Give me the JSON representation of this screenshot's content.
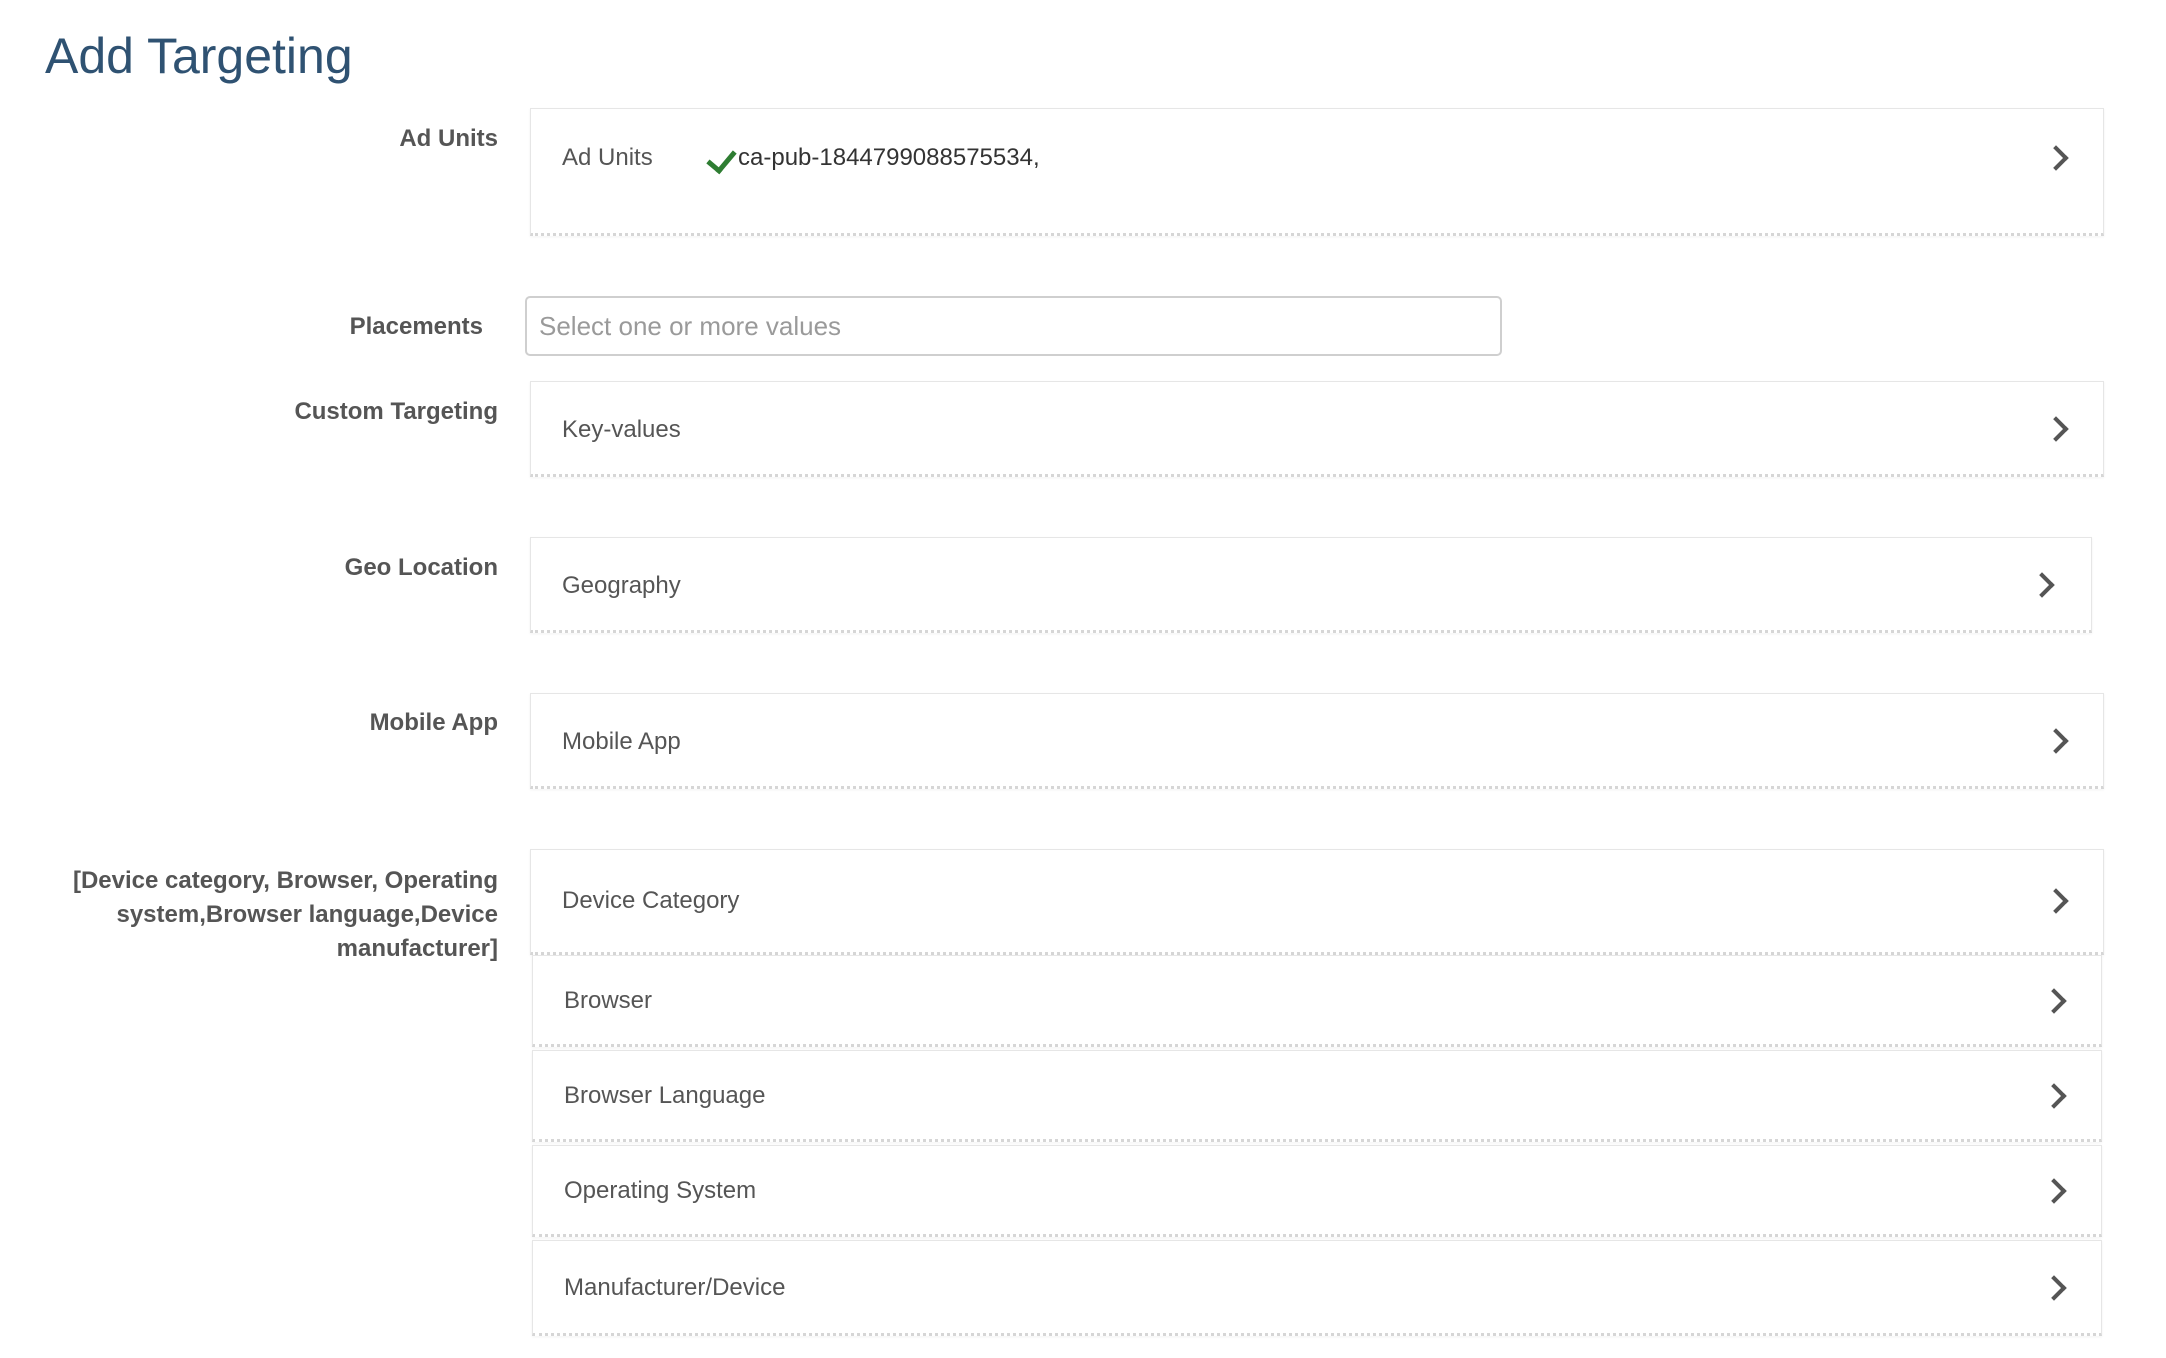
{
  "page": {
    "title": "Add Targeting"
  },
  "rows": {
    "ad_units": {
      "label": "Ad Units",
      "panel_label": "Ad Units",
      "selected_value": "ca-pub-1844799088575534,"
    },
    "placements": {
      "label": "Placements",
      "placeholder": "Select one or more values",
      "value": ""
    },
    "custom_targeting": {
      "label": "Custom Targeting",
      "panel_label": "Key-values"
    },
    "geo_location": {
      "label": "Geo Location",
      "panel_label": "Geography"
    },
    "mobile_app": {
      "label": "Mobile App",
      "panel_label": "Mobile App"
    },
    "technology": {
      "label": "[Device category, Browser, Operating system,Browser language,Device manufacturer]",
      "items": [
        {
          "label": "Device Category"
        },
        {
          "label": "Browser"
        },
        {
          "label": "Browser Language"
        },
        {
          "label": "Operating System"
        },
        {
          "label": "Manufacturer/Device"
        }
      ]
    }
  },
  "icons": {
    "selected_check": "check-icon",
    "expand": "chevron-right-icon"
  },
  "colors": {
    "title": "#2f5272",
    "check": "#2e7d32",
    "label": "#555555"
  }
}
